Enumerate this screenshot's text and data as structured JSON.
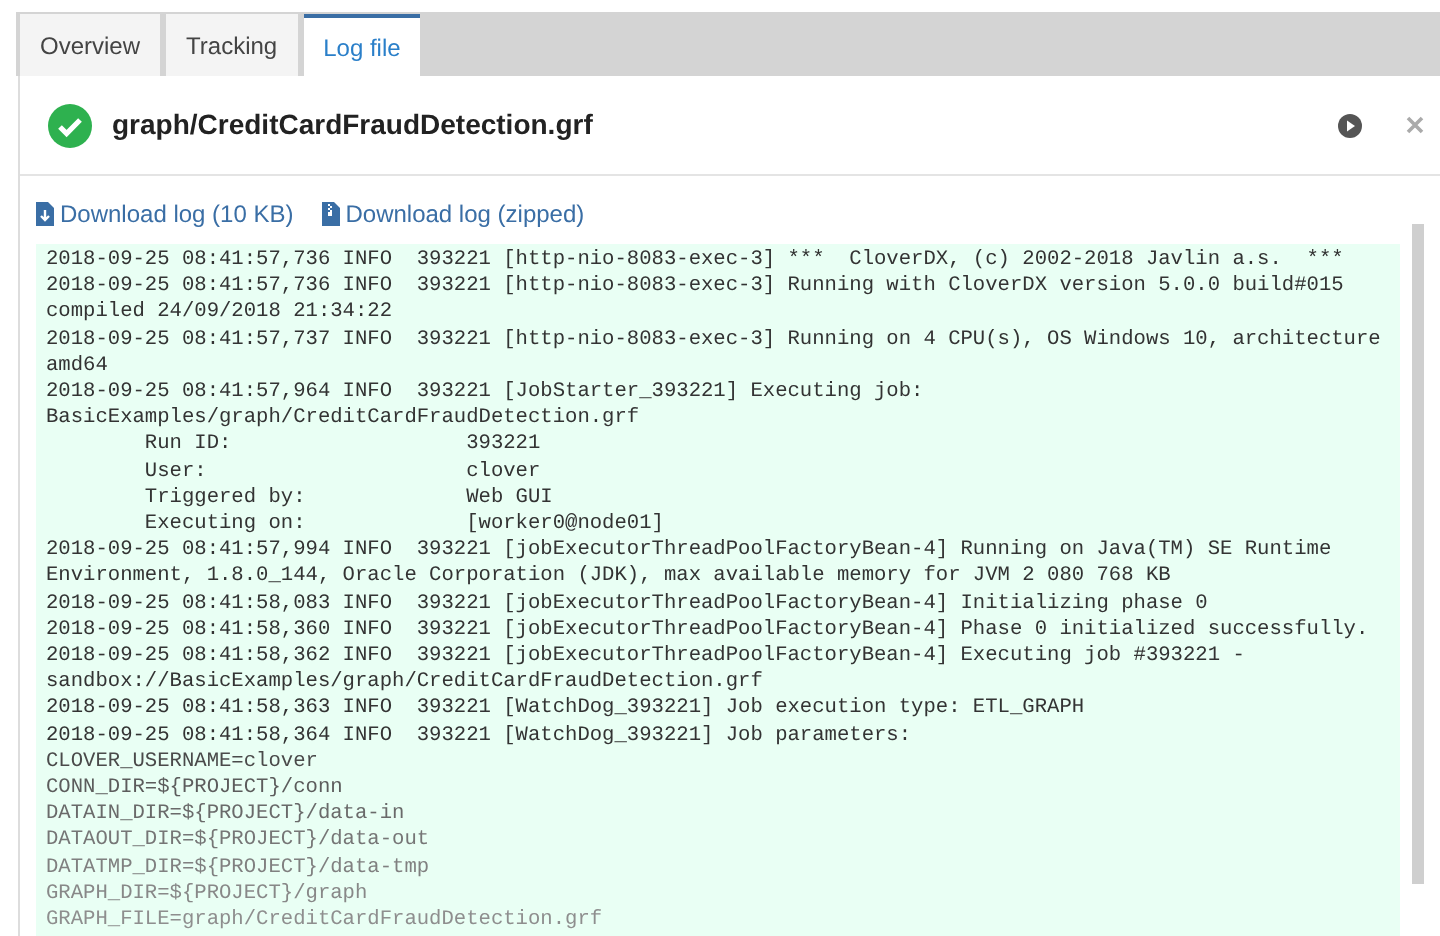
{
  "tabs": [
    {
      "label": "Overview",
      "selected": false
    },
    {
      "label": "Tracking",
      "selected": false
    },
    {
      "label": "Log file",
      "selected": true
    }
  ],
  "header": {
    "succeeded": true,
    "title": "graph/CreditCardFraudDetection.grf"
  },
  "downloads": [
    {
      "label": "Download log (10 KB)",
      "kind": "download"
    },
    {
      "label": "Download log (zipped)",
      "kind": "zip"
    }
  ],
  "log_lines": [
    "2018-09-25 08:41:57,736 INFO  393221 [http-nio-8083-exec-3] ***  CloverDX, (c) 2002-2018 Javlin a.s.  ***",
    "2018-09-25 08:41:57,736 INFO  393221 [http-nio-8083-exec-3] Running with CloverDX version 5.0.0 build#015",
    "compiled 24/09/2018 21:34:22",
    "2018-09-25 08:41:57,737 INFO  393221 [http-nio-8083-exec-3] Running on 4 CPU(s), OS Windows 10, architecture",
    "amd64",
    "2018-09-25 08:41:57,964 INFO  393221 [JobStarter_393221] Executing job:",
    "BasicExamples/graph/CreditCardFraudDetection.grf",
    "        Run ID:                   393221",
    "        User:                     clover",
    "        Triggered by:             Web GUI",
    "        Executing on:             [worker0@node01]",
    "2018-09-25 08:41:57,994 INFO  393221 [jobExecutorThreadPoolFactoryBean-4] Running on Java(TM) SE Runtime",
    "Environment, 1.8.0_144, Oracle Corporation (JDK), max available memory for JVM 2 080 768 KB",
    "2018-09-25 08:41:58,083 INFO  393221 [jobExecutorThreadPoolFactoryBean-4] Initializing phase 0",
    "2018-09-25 08:41:58,360 INFO  393221 [jobExecutorThreadPoolFactoryBean-4] Phase 0 initialized successfully.",
    "2018-09-25 08:41:58,362 INFO  393221 [jobExecutorThreadPoolFactoryBean-4] Executing job #393221 -",
    "sandbox://BasicExamples/graph/CreditCardFraudDetection.grf",
    "2018-09-25 08:41:58,363 INFO  393221 [WatchDog_393221] Job execution type: ETL_GRAPH",
    "2018-09-25 08:41:58,364 INFO  393221 [WatchDog_393221] Job parameters:",
    "CLOVER_USERNAME=clover",
    "CONN_DIR=${PROJECT}/conn",
    "DATAIN_DIR=${PROJECT}/data-in",
    "DATAOUT_DIR=${PROJECT}/data-out",
    "DATATMP_DIR=${PROJECT}/data-tmp",
    "GRAPH_DIR=${PROJECT}/graph",
    "GRAPH_FILE=graph/CreditCardFraudDetection.grf"
  ]
}
